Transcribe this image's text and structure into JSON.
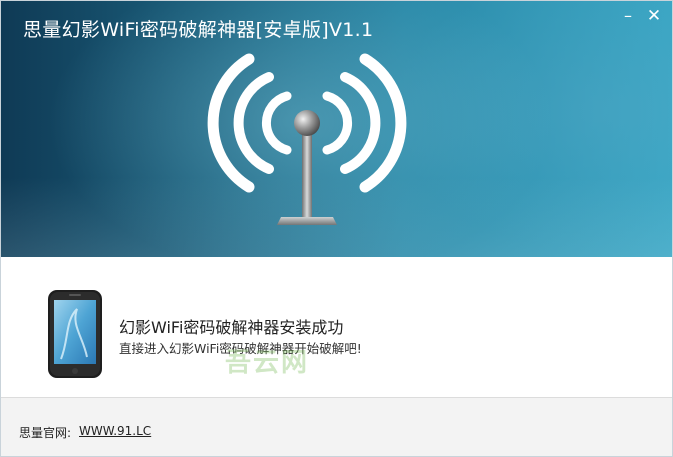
{
  "window": {
    "title": "思量幻影WiFi密码破解神器[安卓版]V1.1",
    "minimize_label": "–",
    "close_label": "✕"
  },
  "banner": {
    "icon": "wifi-antenna-icon"
  },
  "content": {
    "icon": "phone-icon",
    "message_primary": "幻影WiFi密码破解神器安装成功",
    "message_secondary": "直接进入幻影WiFi密码破解神器开始破解吧!",
    "watermark": "吾云网"
  },
  "footer": {
    "site_label": "思量官网:",
    "site_link": "WWW.91.LC"
  },
  "colors": {
    "banner_dark": "#0f3a55",
    "banner_light": "#3aa6c4",
    "footer_bg": "#f3f3f3"
  }
}
